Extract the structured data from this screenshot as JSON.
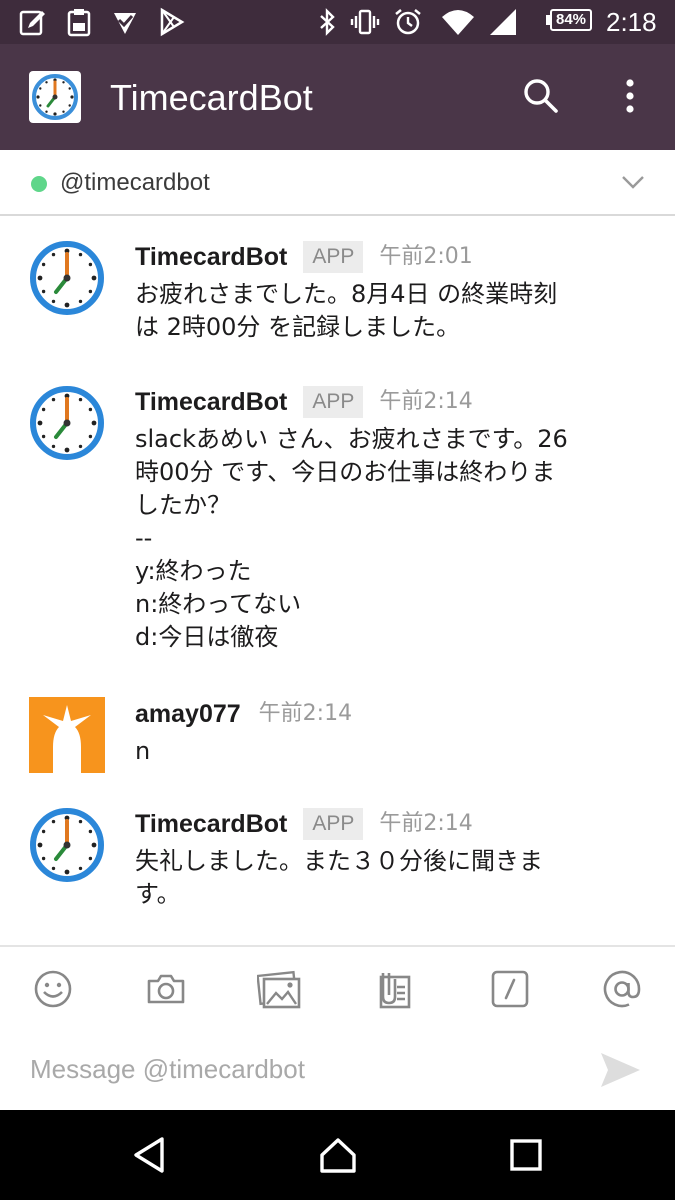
{
  "status_bar": {
    "battery": "84%",
    "time": "2:18",
    "left_icons": [
      "edit-note-icon",
      "clipboard-icon",
      "check-download-icon",
      "play-store-icon"
    ],
    "right_icons": [
      "bluetooth-icon",
      "vibrate-icon",
      "alarm-icon",
      "wifi-icon",
      "signal-icon"
    ]
  },
  "app_bar": {
    "title": "TimecardBot",
    "icons": [
      "clock-icon",
      "search-icon",
      "more-vert-icon"
    ]
  },
  "channel": {
    "name": "@timecardbot",
    "presence": "online",
    "presence_color": "#5fd68a"
  },
  "messages": [
    {
      "sender": "TimecardBot",
      "badge": "APP",
      "time": "午前2:01",
      "avatar": "clock-icon",
      "lines": [
        "お疲れさまでした。8月4日 の終業時刻",
        "は 2時00分 を記録しました。"
      ]
    },
    {
      "sender": "TimecardBot",
      "badge": "APP",
      "time": "午前2:14",
      "avatar": "clock-icon",
      "lines": [
        "slackあめい さん、お疲れさまです。26",
        "時00分 です、今日のお仕事は終わりま",
        "したか？",
        "--",
        "y:終わった",
        "n:終わってない",
        "d:今日は徹夜"
      ]
    },
    {
      "sender": "amay077",
      "time": "午前2:14",
      "avatar": "user-avatar",
      "avatar_color": "#f7941d",
      "lines": [
        "n"
      ]
    },
    {
      "sender": "TimecardBot",
      "badge": "APP",
      "time": "午前2:14",
      "avatar": "clock-icon",
      "lines": [
        "失礼しました。また３０分後に聞きま",
        "す。"
      ]
    }
  ],
  "toolbar": {
    "icons": [
      "emoji-icon",
      "camera-icon",
      "gallery-icon",
      "file-icon",
      "slash-command-icon",
      "mention-icon"
    ]
  },
  "composer": {
    "placeholder": "Message @timecardbot",
    "value": "",
    "send_icon": "send-icon"
  },
  "nav_bar": {
    "icons": [
      "back-icon",
      "home-icon",
      "recents-icon"
    ]
  },
  "colors": {
    "status_bar": "#3e2c3c",
    "app_bar": "#4a3648",
    "badge_bg": "#ececec"
  }
}
